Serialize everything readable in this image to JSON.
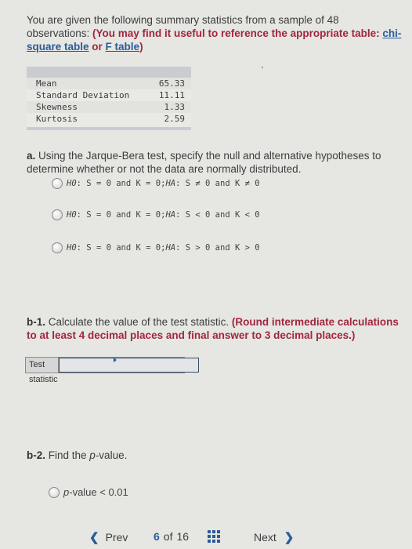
{
  "intro": {
    "text": "You are given the following summary statistics from a sample of 48 observations: ",
    "instruction": "(You may find it useful to reference the appropriate table: ",
    "link_chi": "chi-square table",
    "or": " or ",
    "link_f": "F table",
    "close": ")"
  },
  "stats_table": {
    "rows": [
      {
        "label": "Mean",
        "value": "65.33"
      },
      {
        "label": "Standard Deviation",
        "value": "11.11"
      },
      {
        "label": "Skewness",
        "value": "1.33"
      },
      {
        "label": "Kurtosis",
        "value": "2.59"
      }
    ]
  },
  "part_a": {
    "label": "a.",
    "text": " Using the Jarque-Bera test, specify the null and alternative hypotheses to determine whether or not the data are normally distributed.",
    "options": [
      {
        "h0": "H0",
        "h0_text": ": S = 0 and K = 0; ",
        "ha": "HA",
        "ha_text": ": S ≠ 0 and K ≠ 0"
      },
      {
        "h0": "H0",
        "h0_text": ": S = 0 and K = 0; ",
        "ha": "HA",
        "ha_text": ": S < 0 and K < 0"
      },
      {
        "h0": "H0",
        "h0_text": ": S = 0 and K = 0; ",
        "ha": "HA",
        "ha_text": ": S > 0 and K > 0"
      }
    ]
  },
  "part_b1": {
    "label": "b-1.",
    "text": " Calculate the value of the test statistic. ",
    "instruction": "(Round intermediate calculations to at least 4 decimal places and final answer to 3 decimal places.)",
    "input_label": "Test statistic",
    "input_value": ""
  },
  "part_b2": {
    "label": "b-2.",
    "text_before": " Find the ",
    "p": "p",
    "text_after": "-value.",
    "option_p": "p",
    "option_text": "-value < 0.01"
  },
  "nav": {
    "prev": "Prev",
    "current": "6",
    "of": "of",
    "total": "16",
    "next": "Next"
  },
  "colors": {
    "accent": "#2a5c9a",
    "instruction_red": "#a3263d"
  }
}
